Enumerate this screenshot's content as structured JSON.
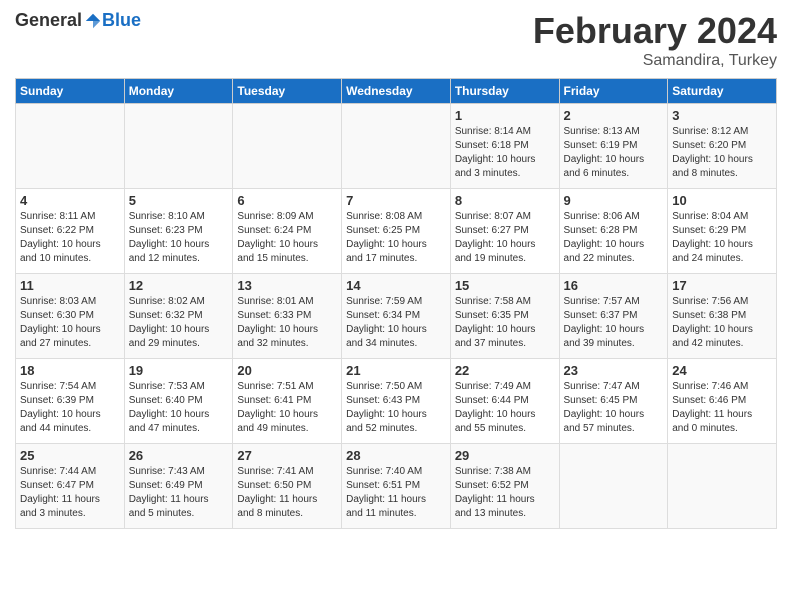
{
  "header": {
    "logo_general": "General",
    "logo_blue": "Blue",
    "month_title": "February 2024",
    "location": "Samandira, Turkey"
  },
  "columns": [
    "Sunday",
    "Monday",
    "Tuesday",
    "Wednesday",
    "Thursday",
    "Friday",
    "Saturday"
  ],
  "weeks": [
    [
      {
        "day": "",
        "info": ""
      },
      {
        "day": "",
        "info": ""
      },
      {
        "day": "",
        "info": ""
      },
      {
        "day": "",
        "info": ""
      },
      {
        "day": "1",
        "info": "Sunrise: 8:14 AM\nSunset: 6:18 PM\nDaylight: 10 hours\nand 3 minutes."
      },
      {
        "day": "2",
        "info": "Sunrise: 8:13 AM\nSunset: 6:19 PM\nDaylight: 10 hours\nand 6 minutes."
      },
      {
        "day": "3",
        "info": "Sunrise: 8:12 AM\nSunset: 6:20 PM\nDaylight: 10 hours\nand 8 minutes."
      }
    ],
    [
      {
        "day": "4",
        "info": "Sunrise: 8:11 AM\nSunset: 6:22 PM\nDaylight: 10 hours\nand 10 minutes."
      },
      {
        "day": "5",
        "info": "Sunrise: 8:10 AM\nSunset: 6:23 PM\nDaylight: 10 hours\nand 12 minutes."
      },
      {
        "day": "6",
        "info": "Sunrise: 8:09 AM\nSunset: 6:24 PM\nDaylight: 10 hours\nand 15 minutes."
      },
      {
        "day": "7",
        "info": "Sunrise: 8:08 AM\nSunset: 6:25 PM\nDaylight: 10 hours\nand 17 minutes."
      },
      {
        "day": "8",
        "info": "Sunrise: 8:07 AM\nSunset: 6:27 PM\nDaylight: 10 hours\nand 19 minutes."
      },
      {
        "day": "9",
        "info": "Sunrise: 8:06 AM\nSunset: 6:28 PM\nDaylight: 10 hours\nand 22 minutes."
      },
      {
        "day": "10",
        "info": "Sunrise: 8:04 AM\nSunset: 6:29 PM\nDaylight: 10 hours\nand 24 minutes."
      }
    ],
    [
      {
        "day": "11",
        "info": "Sunrise: 8:03 AM\nSunset: 6:30 PM\nDaylight: 10 hours\nand 27 minutes."
      },
      {
        "day": "12",
        "info": "Sunrise: 8:02 AM\nSunset: 6:32 PM\nDaylight: 10 hours\nand 29 minutes."
      },
      {
        "day": "13",
        "info": "Sunrise: 8:01 AM\nSunset: 6:33 PM\nDaylight: 10 hours\nand 32 minutes."
      },
      {
        "day": "14",
        "info": "Sunrise: 7:59 AM\nSunset: 6:34 PM\nDaylight: 10 hours\nand 34 minutes."
      },
      {
        "day": "15",
        "info": "Sunrise: 7:58 AM\nSunset: 6:35 PM\nDaylight: 10 hours\nand 37 minutes."
      },
      {
        "day": "16",
        "info": "Sunrise: 7:57 AM\nSunset: 6:37 PM\nDaylight: 10 hours\nand 39 minutes."
      },
      {
        "day": "17",
        "info": "Sunrise: 7:56 AM\nSunset: 6:38 PM\nDaylight: 10 hours\nand 42 minutes."
      }
    ],
    [
      {
        "day": "18",
        "info": "Sunrise: 7:54 AM\nSunset: 6:39 PM\nDaylight: 10 hours\nand 44 minutes."
      },
      {
        "day": "19",
        "info": "Sunrise: 7:53 AM\nSunset: 6:40 PM\nDaylight: 10 hours\nand 47 minutes."
      },
      {
        "day": "20",
        "info": "Sunrise: 7:51 AM\nSunset: 6:41 PM\nDaylight: 10 hours\nand 49 minutes."
      },
      {
        "day": "21",
        "info": "Sunrise: 7:50 AM\nSunset: 6:43 PM\nDaylight: 10 hours\nand 52 minutes."
      },
      {
        "day": "22",
        "info": "Sunrise: 7:49 AM\nSunset: 6:44 PM\nDaylight: 10 hours\nand 55 minutes."
      },
      {
        "day": "23",
        "info": "Sunrise: 7:47 AM\nSunset: 6:45 PM\nDaylight: 10 hours\nand 57 minutes."
      },
      {
        "day": "24",
        "info": "Sunrise: 7:46 AM\nSunset: 6:46 PM\nDaylight: 11 hours\nand 0 minutes."
      }
    ],
    [
      {
        "day": "25",
        "info": "Sunrise: 7:44 AM\nSunset: 6:47 PM\nDaylight: 11 hours\nand 3 minutes."
      },
      {
        "day": "26",
        "info": "Sunrise: 7:43 AM\nSunset: 6:49 PM\nDaylight: 11 hours\nand 5 minutes."
      },
      {
        "day": "27",
        "info": "Sunrise: 7:41 AM\nSunset: 6:50 PM\nDaylight: 11 hours\nand 8 minutes."
      },
      {
        "day": "28",
        "info": "Sunrise: 7:40 AM\nSunset: 6:51 PM\nDaylight: 11 hours\nand 11 minutes."
      },
      {
        "day": "29",
        "info": "Sunrise: 7:38 AM\nSunset: 6:52 PM\nDaylight: 11 hours\nand 13 minutes."
      },
      {
        "day": "",
        "info": ""
      },
      {
        "day": "",
        "info": ""
      }
    ]
  ]
}
